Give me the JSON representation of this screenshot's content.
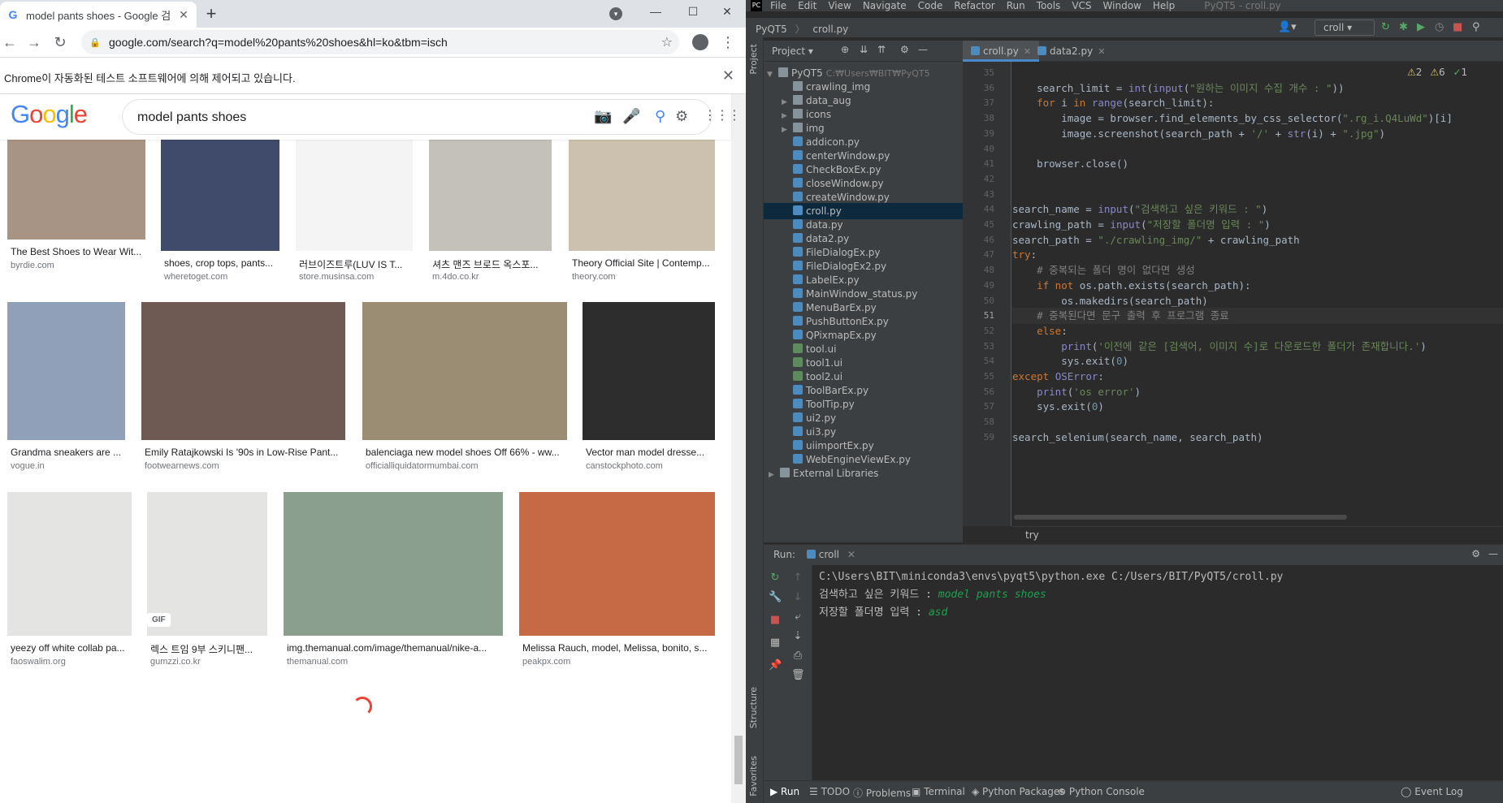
{
  "chrome": {
    "tab_title": "model pants shoes - Google 검",
    "favicon": "G",
    "new_tab": "+",
    "url": "google.com/search?q=model%20pants%20shoes&hl=ko&tbm=isch",
    "infobar": "Chrome이 자동화된 테스트 소프트웨어에 의해 제어되고 있습니다.",
    "search_query": "model pants shoes",
    "logo": [
      "G",
      "o",
      "o",
      "g",
      "l",
      "e"
    ],
    "logo_colors": [
      "#4285f4",
      "#ea4335",
      "#fbbc05",
      "#4285f4",
      "#34a853",
      "#ea4335"
    ]
  },
  "results": [
    {
      "title": "The Best Shoes to Wear Wit...",
      "site": "byrdie.com",
      "color": "#a89484"
    },
    {
      "title": "shoes, crop tops, pants...",
      "site": "wheretoget.com",
      "color": "#404a6a"
    },
    {
      "title": "러브이즈트루(LUV IS T...",
      "site": "store.musinsa.com",
      "color": "#f4f4f4"
    },
    {
      "title": "셔츠 맨즈 브로드 옥스포...",
      "site": "m.4do.co.kr",
      "color": "#c4c0ba"
    },
    {
      "title": "Theory Official Site | Contemp...",
      "site": "theory.com",
      "color": "#cbc1ae"
    },
    {
      "title": "Grandma sneakers are ...",
      "site": "vogue.in",
      "color": "#8fa0b8"
    },
    {
      "title": "Emily Ratajkowski Is '90s in Low-Rise Pant...",
      "site": "footwearnews.com",
      "color": "#6e5a52"
    },
    {
      "title": "balenciaga new model shoes Off 66% - ww...",
      "site": "officialliquidatormumbai.com",
      "color": "#9b8d74"
    },
    {
      "title": "Vector man model dresse...",
      "site": "canstockphoto.com",
      "color": "#2d2d2d"
    },
    {
      "title": "yeezy off white collab pa...",
      "site": "faoswalim.org",
      "color": "#e4e5e3"
    },
    {
      "title": "렉스 트임 9부 스키니팬...",
      "site": "gumzzi.co.kr",
      "color": "#e4e5e3"
    },
    {
      "title": "img.themanual.com/image/themanual/nike-a...",
      "site": "themanual.com",
      "color": "#8b9f8e"
    },
    {
      "title": "Melissa Rauch, model, Melissa, bonito, s...",
      "site": "peakpx.com",
      "color": "#c56a45"
    }
  ],
  "gif_badge": "GIF",
  "ide": {
    "menu": [
      "File",
      "Edit",
      "View",
      "Navigate",
      "Code",
      "Refactor",
      "Run",
      "Tools",
      "VCS",
      "Window",
      "Help"
    ],
    "window_title": "PyQT5 - croll.py",
    "breadcrumb_project": "PyQT5",
    "breadcrumb_file": "croll.py",
    "run_config": "croll",
    "project_label": "Project",
    "tree_root": "PyQT5",
    "tree_root_path": "C:₩Users₩BIT₩PyQT5",
    "tree_items": [
      {
        "name": "crawling_img",
        "kind": "folder",
        "expandable": false
      },
      {
        "name": "data_aug",
        "kind": "folder",
        "expandable": true
      },
      {
        "name": "icons",
        "kind": "folder",
        "expandable": true
      },
      {
        "name": "img",
        "kind": "folder",
        "expandable": true
      },
      {
        "name": "addicon.py",
        "kind": "py"
      },
      {
        "name": "centerWindow.py",
        "kind": "py"
      },
      {
        "name": "CheckBoxEx.py",
        "kind": "py"
      },
      {
        "name": "closeWindow.py",
        "kind": "py"
      },
      {
        "name": "createWindow.py",
        "kind": "py"
      },
      {
        "name": "croll.py",
        "kind": "py",
        "selected": true
      },
      {
        "name": "data.py",
        "kind": "py"
      },
      {
        "name": "data2.py",
        "kind": "py"
      },
      {
        "name": "FileDialogEx.py",
        "kind": "py"
      },
      {
        "name": "FileDialogEx2.py",
        "kind": "py"
      },
      {
        "name": "LabelEx.py",
        "kind": "py"
      },
      {
        "name": "MainWindow_status.py",
        "kind": "py"
      },
      {
        "name": "MenuBarEx.py",
        "kind": "py"
      },
      {
        "name": "PushButtonEx.py",
        "kind": "py"
      },
      {
        "name": "QPixmapEx.py",
        "kind": "py"
      },
      {
        "name": "tool.ui",
        "kind": "ui"
      },
      {
        "name": "tool1.ui",
        "kind": "ui"
      },
      {
        "name": "tool2.ui",
        "kind": "ui"
      },
      {
        "name": "ToolBarEx.py",
        "kind": "py"
      },
      {
        "name": "ToolTip.py",
        "kind": "py"
      },
      {
        "name": "ui2.py",
        "kind": "py"
      },
      {
        "name": "ui3.py",
        "kind": "py"
      },
      {
        "name": "uiimportEx.py",
        "kind": "py"
      },
      {
        "name": "WebEngineViewEx.py",
        "kind": "py"
      }
    ],
    "tree_external": "External Libraries",
    "editor_tabs": [
      "croll.py",
      "data2.py"
    ],
    "inspections": {
      "warnings": "2",
      "weak": "6",
      "ok": "1"
    },
    "code_lines": [
      {
        "n": "35",
        "t": [
          {
            "c": "id",
            "s": ""
          }
        ]
      },
      {
        "n": "36",
        "t": [
          {
            "c": "id",
            "s": "    search_limit = "
          },
          {
            "c": "fn",
            "s": "int"
          },
          {
            "c": "id",
            "s": "("
          },
          {
            "c": "fn",
            "s": "input"
          },
          {
            "c": "id",
            "s": "("
          },
          {
            "c": "st",
            "s": "\"원하는 이미지 수집 개수 : \""
          },
          {
            "c": "id",
            "s": "))"
          }
        ]
      },
      {
        "n": "37",
        "t": [
          {
            "c": "kw",
            "s": "    for "
          },
          {
            "c": "id",
            "s": "i "
          },
          {
            "c": "kw",
            "s": "in "
          },
          {
            "c": "fn",
            "s": "range"
          },
          {
            "c": "id",
            "s": "(search_limit):"
          }
        ]
      },
      {
        "n": "38",
        "t": [
          {
            "c": "id",
            "s": "        image = browser.find_elements_by_css_selector("
          },
          {
            "c": "st",
            "s": "\".rg_i.Q4LuWd\""
          },
          {
            "c": "id",
            "s": ")[i]"
          }
        ]
      },
      {
        "n": "39",
        "t": [
          {
            "c": "id",
            "s": "        image.screenshot(search_path + "
          },
          {
            "c": "st",
            "s": "'/'"
          },
          {
            "c": "id",
            "s": " + "
          },
          {
            "c": "fn",
            "s": "str"
          },
          {
            "c": "id",
            "s": "(i) + "
          },
          {
            "c": "st",
            "s": "\".jpg\""
          },
          {
            "c": "id",
            "s": ")"
          }
        ]
      },
      {
        "n": "40",
        "t": [
          {
            "c": "id",
            "s": ""
          }
        ]
      },
      {
        "n": "41",
        "t": [
          {
            "c": "id",
            "s": "    browser.close()"
          }
        ]
      },
      {
        "n": "42",
        "t": [
          {
            "c": "id",
            "s": ""
          }
        ]
      },
      {
        "n": "43",
        "t": [
          {
            "c": "id",
            "s": ""
          }
        ]
      },
      {
        "n": "44",
        "t": [
          {
            "c": "id",
            "s": "search_name = "
          },
          {
            "c": "fn",
            "s": "input"
          },
          {
            "c": "id",
            "s": "("
          },
          {
            "c": "st",
            "s": "\"검색하고 싶은 키워드 : \""
          },
          {
            "c": "id",
            "s": ")"
          }
        ]
      },
      {
        "n": "45",
        "t": [
          {
            "c": "id",
            "s": "crawling_path = "
          },
          {
            "c": "fn",
            "s": "input"
          },
          {
            "c": "id",
            "s": "("
          },
          {
            "c": "st",
            "s": "\"저장할 폴더명 입력 : \""
          },
          {
            "c": "id",
            "s": ")"
          }
        ]
      },
      {
        "n": "46",
        "t": [
          {
            "c": "id",
            "s": "search_path = "
          },
          {
            "c": "st",
            "s": "\"./crawling_img/\""
          },
          {
            "c": "id",
            "s": " + crawling_path"
          }
        ]
      },
      {
        "n": "47",
        "t": [
          {
            "c": "kw",
            "s": "try"
          },
          {
            "c": "id",
            "s": ":"
          }
        ]
      },
      {
        "n": "48",
        "t": [
          {
            "c": "cm",
            "s": "    # 중복되는 폴더 명이 없다면 생성"
          }
        ]
      },
      {
        "n": "49",
        "t": [
          {
            "c": "kw",
            "s": "    if not "
          },
          {
            "c": "id",
            "s": "os.path.exists(search_path):"
          }
        ]
      },
      {
        "n": "50",
        "t": [
          {
            "c": "id",
            "s": "        os.makedirs(search_path)"
          }
        ]
      },
      {
        "n": "51",
        "t": [
          {
            "c": "cm",
            "s": "    # 중복된다면 문구 출력 후 프로그램 종료"
          }
        ],
        "current": true
      },
      {
        "n": "52",
        "t": [
          {
            "c": "kw",
            "s": "    else"
          },
          {
            "c": "id",
            "s": ":"
          }
        ]
      },
      {
        "n": "53",
        "t": [
          {
            "c": "id",
            "s": "        "
          },
          {
            "c": "fn",
            "s": "print"
          },
          {
            "c": "id",
            "s": "("
          },
          {
            "c": "st",
            "s": "'이전에 같은 [검색어, 이미지 수]로 다운로드한 폴더가 존재합니다.'"
          },
          {
            "c": "id",
            "s": ")"
          }
        ]
      },
      {
        "n": "54",
        "t": [
          {
            "c": "id",
            "s": "        sys.exit("
          },
          {
            "c": "nm",
            "s": "0"
          },
          {
            "c": "id",
            "s": ")"
          }
        ]
      },
      {
        "n": "55",
        "t": [
          {
            "c": "kw",
            "s": "except "
          },
          {
            "c": "fn",
            "s": "OSError"
          },
          {
            "c": "id",
            "s": ":"
          }
        ]
      },
      {
        "n": "56",
        "t": [
          {
            "c": "id",
            "s": "    "
          },
          {
            "c": "fn",
            "s": "print"
          },
          {
            "c": "id",
            "s": "("
          },
          {
            "c": "st",
            "s": "'os error'"
          },
          {
            "c": "id",
            "s": ")"
          }
        ]
      },
      {
        "n": "57",
        "t": [
          {
            "c": "id",
            "s": "    sys.exit("
          },
          {
            "c": "nm",
            "s": "0"
          },
          {
            "c": "id",
            "s": ")"
          }
        ]
      },
      {
        "n": "58",
        "t": [
          {
            "c": "id",
            "s": ""
          }
        ]
      },
      {
        "n": "59",
        "t": [
          {
            "c": "id",
            "s": "search_selenium(search_name, search_path)"
          }
        ]
      }
    ],
    "code_breadcrumb": "try",
    "run_label": "Run:",
    "run_tab": "croll",
    "console": [
      {
        "prompt": "C:\\Users\\BIT\\miniconda3\\envs\\pyqt5\\python.exe C:/Users/BIT/PyQT5/croll.py",
        "input": ""
      },
      {
        "prompt": "검색하고 싶은 키워드 : ",
        "input": "model pants shoes"
      },
      {
        "prompt": "저장할 폴더명 입력 : ",
        "input": "asd"
      }
    ],
    "status_tabs": [
      "Run",
      "TODO",
      "Problems",
      "Terminal",
      "Python Packages",
      "Python Console"
    ],
    "event_log": "Event Log",
    "side_structure": "Structure",
    "side_favorites": "Favorites",
    "side_project": "Project"
  }
}
